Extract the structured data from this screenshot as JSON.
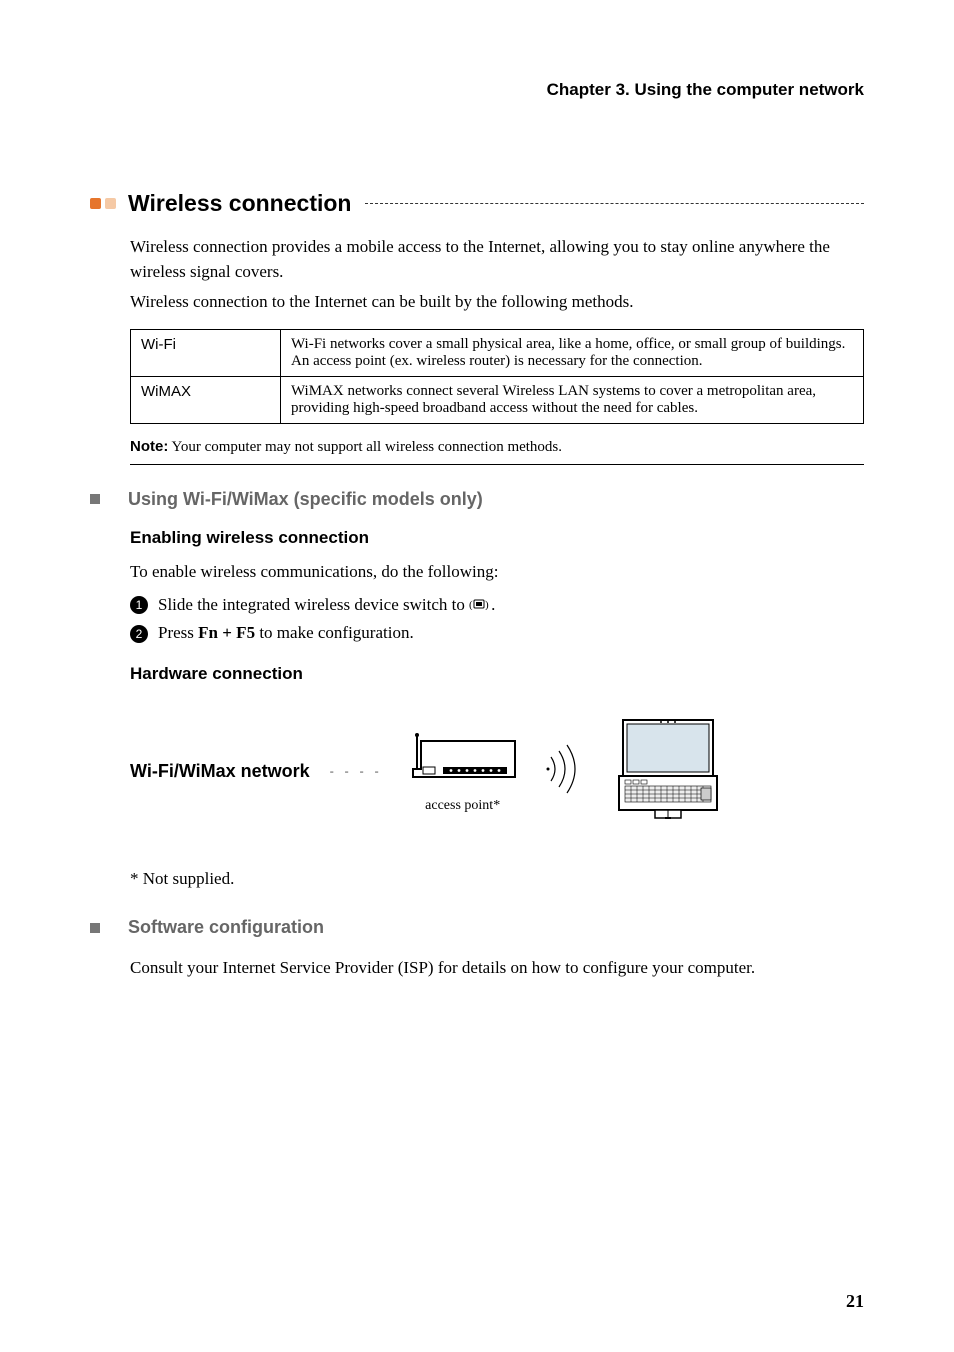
{
  "chapter_header": "Chapter 3. Using the computer network",
  "section_title": "Wireless connection",
  "intro_p1": "Wireless connection provides a mobile access to the Internet, allowing you to stay online anywhere the wireless signal covers.",
  "intro_p2": "Wireless connection to the Internet can be built by the following methods.",
  "table": {
    "rows": [
      {
        "term": "Wi-Fi",
        "desc": "Wi-Fi networks cover a small physical area, like a home, office, or small group of buildings. An access point (ex. wireless router) is necessary for the connection."
      },
      {
        "term": "WiMAX",
        "desc": "WiMAX networks connect several Wireless LAN systems to cover a metropolitan area, providing high-speed broadband access without the need for cables."
      }
    ]
  },
  "note_label": "Note:",
  "note_text": " Your computer may not support all wireless connection methods.",
  "sub1_title": "Using Wi-Fi/WiMax (specific models only)",
  "h3_enable": "Enabling wireless connection",
  "enable_intro": "To enable wireless communications, do the following:",
  "steps": {
    "s1a": "Slide the integrated wireless device switch to ",
    "s1b": ".",
    "s2a": "Press ",
    "s2b": "Fn + F5",
    "s2c": " to make configuration."
  },
  "h3_hw": "Hardware connection",
  "diagram": {
    "label": "Wi-Fi/WiMax network",
    "ap_caption": "access point*"
  },
  "footnote": "* Not supplied.",
  "sub2_title": "Software configuration",
  "soft_text": "Consult your Internet Service Provider (ISP) for details on how to configure your computer.",
  "page_num": "21"
}
